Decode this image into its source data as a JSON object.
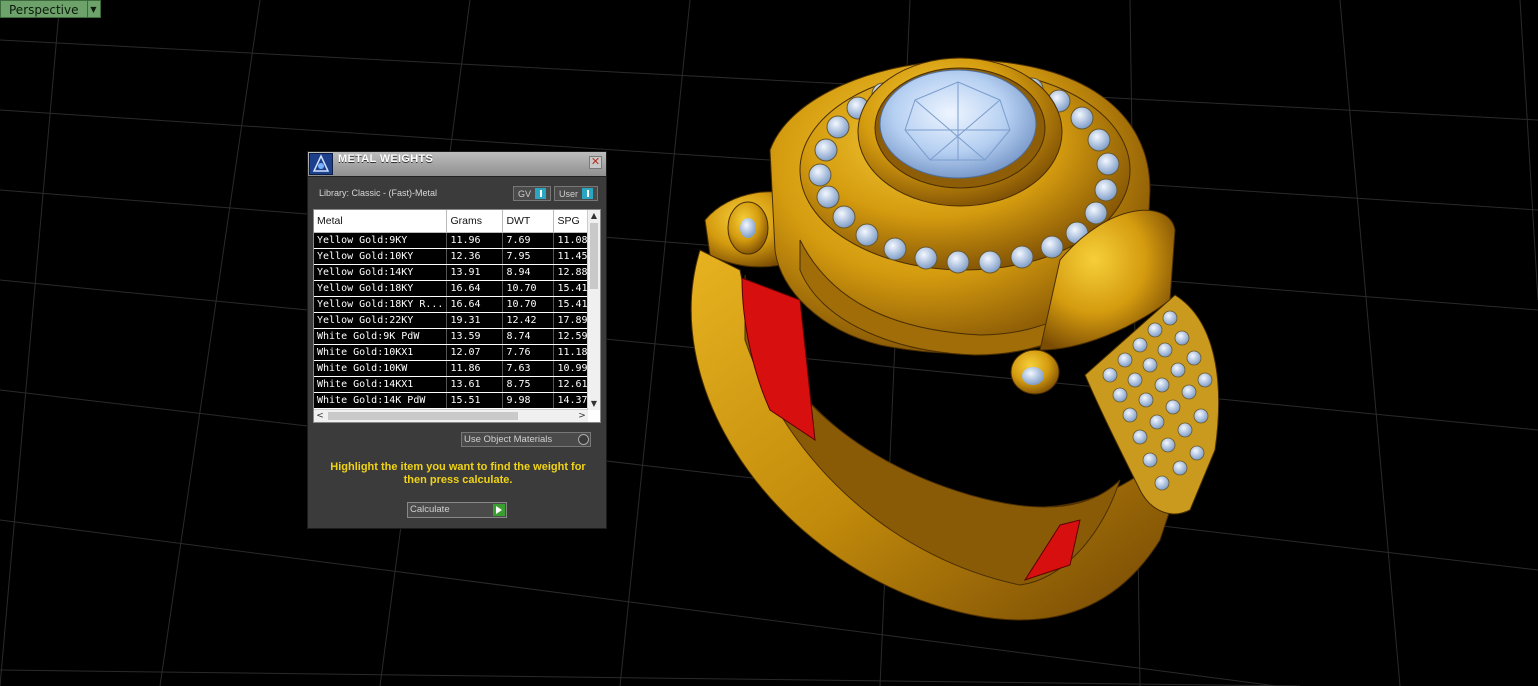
{
  "viewport": {
    "tab_label": "Perspective"
  },
  "panel": {
    "title": "METAL WEIGHTS",
    "library": "Library: Classic - (Fast)-Metal",
    "toggle_gv": "GV",
    "toggle_user": "User",
    "columns": [
      "Metal",
      "Grams",
      "DWT",
      "SPG"
    ],
    "rows": [
      [
        "Yellow Gold:9KY",
        "11.96",
        "7.69",
        "11.08"
      ],
      [
        "Yellow Gold:10KY",
        "12.36",
        "7.95",
        "11.45"
      ],
      [
        "Yellow Gold:14KY",
        "13.91",
        "8.94",
        "12.88"
      ],
      [
        "Yellow Gold:18KY",
        "16.64",
        "10.70",
        "15.41"
      ],
      [
        "Yellow Gold:18KY R...",
        "16.64",
        "10.70",
        "15.41"
      ],
      [
        "Yellow Gold:22KY",
        "19.31",
        "12.42",
        "17.89"
      ],
      [
        "White Gold:9K PdW",
        "13.59",
        "8.74",
        "12.59"
      ],
      [
        "White Gold:10KX1",
        "12.07",
        "7.76",
        "11.18"
      ],
      [
        "White Gold:10KW",
        "11.86",
        "7.63",
        "10.99"
      ],
      [
        "White Gold:14KX1",
        "13.61",
        "8.75",
        "12.61"
      ],
      [
        "White Gold:14K PdW",
        "15.51",
        "9.98",
        "14.37"
      ]
    ],
    "use_object_materials": "Use Object Materials",
    "hint": "Highlight the item you want to find the weight for then press calculate.",
    "calculate_label": "Calculate"
  },
  "colors": {
    "gold": "#d4a010",
    "stone": "#b9d3f4",
    "enamel": "#e01010",
    "hint_text": "#f0d317"
  }
}
